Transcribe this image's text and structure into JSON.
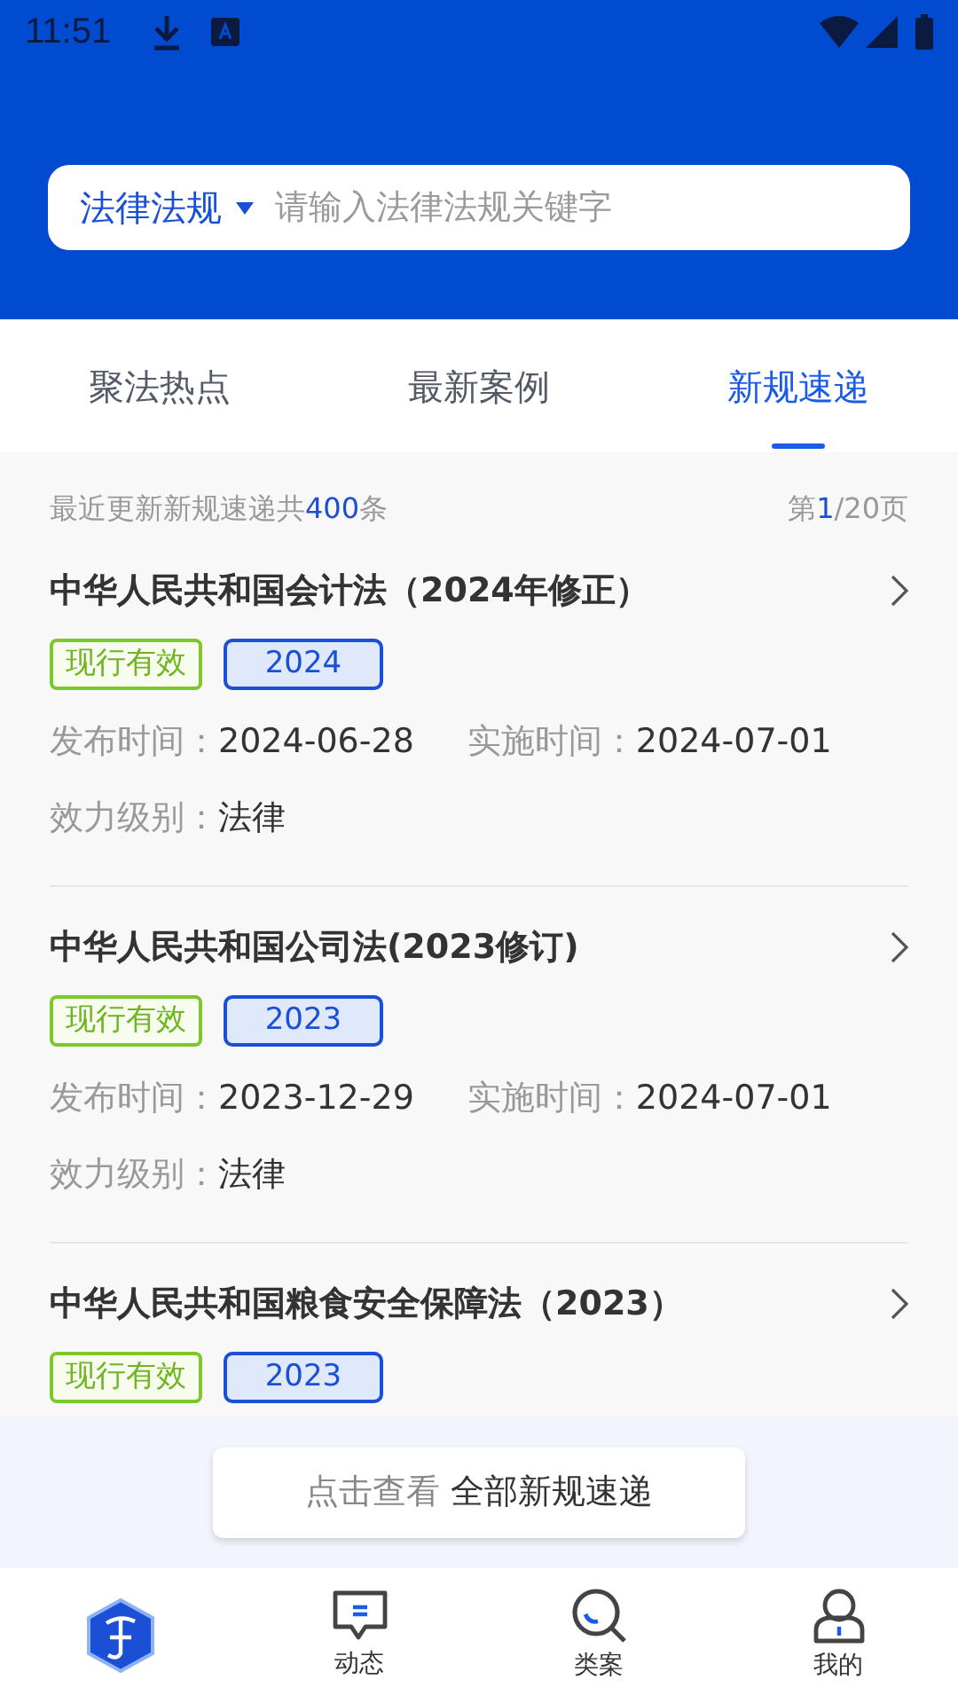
{
  "status_bar": {
    "time": "11:51"
  },
  "search": {
    "scope": "法律法规",
    "placeholder": "请输入法律法规关键字"
  },
  "tabs": [
    {
      "label": "聚法热点",
      "selected": false
    },
    {
      "label": "最新案例",
      "selected": false
    },
    {
      "label": "新规速递",
      "selected": true
    }
  ],
  "summary": {
    "text": "最近更新新规速递共**400**条",
    "page": "第**1**/20页"
  },
  "items": [
    {
      "title": "中华人民共和国会计法（2024年修正）",
      "status": "现行有效",
      "year": "2024",
      "fields": [
        {
          "label": "发布时间：",
          "value": "2024-06-28"
        },
        {
          "label": "实施时间：",
          "value": "2024-07-01"
        },
        {
          "label": "效力级别：",
          "value": "法律"
        }
      ]
    },
    {
      "title": "中华人民共和国公司法(2023修订)",
      "status": "现行有效",
      "year": "2023",
      "fields": [
        {
          "label": "发布时间：",
          "value": "2023-12-29"
        },
        {
          "label": "实施时间：",
          "value": "2024-07-01"
        },
        {
          "label": "效力级别：",
          "value": "法律"
        }
      ]
    },
    {
      "title": "中华人民共和国粮食安全保障法（2023）",
      "status": "现行有效",
      "year": "2023"
    }
  ],
  "view_all": {
    "prefix": "点击查看",
    "label": "全部新规速递"
  },
  "bottom_nav": [
    {
      "kind": "home"
    },
    {
      "kind": "feed",
      "label": "动态"
    },
    {
      "kind": "cases",
      "label": "类案"
    },
    {
      "kind": "me",
      "label": "我的"
    }
  ]
}
